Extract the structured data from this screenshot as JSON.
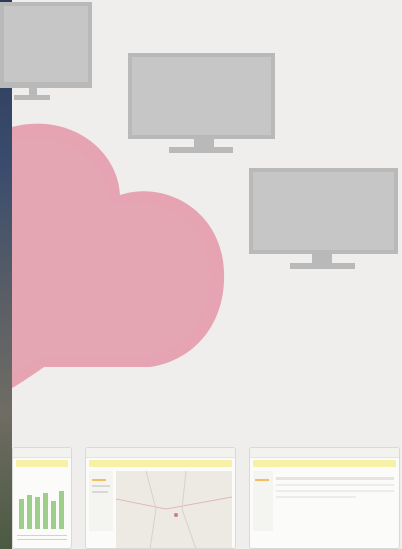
{
  "colors": {
    "background": "#efeeec",
    "cloud": "#e6a3b2",
    "monitor": "#b9b9b9",
    "monitor_screen": "#c6c6c6",
    "thumb_highlight": "#f7f0a8"
  },
  "icons": [
    "monitor-icon",
    "cloud-icon"
  ],
  "thumbnails": [
    {
      "kind": "bar-chart-report"
    },
    {
      "kind": "map-view"
    },
    {
      "kind": "data-table"
    }
  ]
}
